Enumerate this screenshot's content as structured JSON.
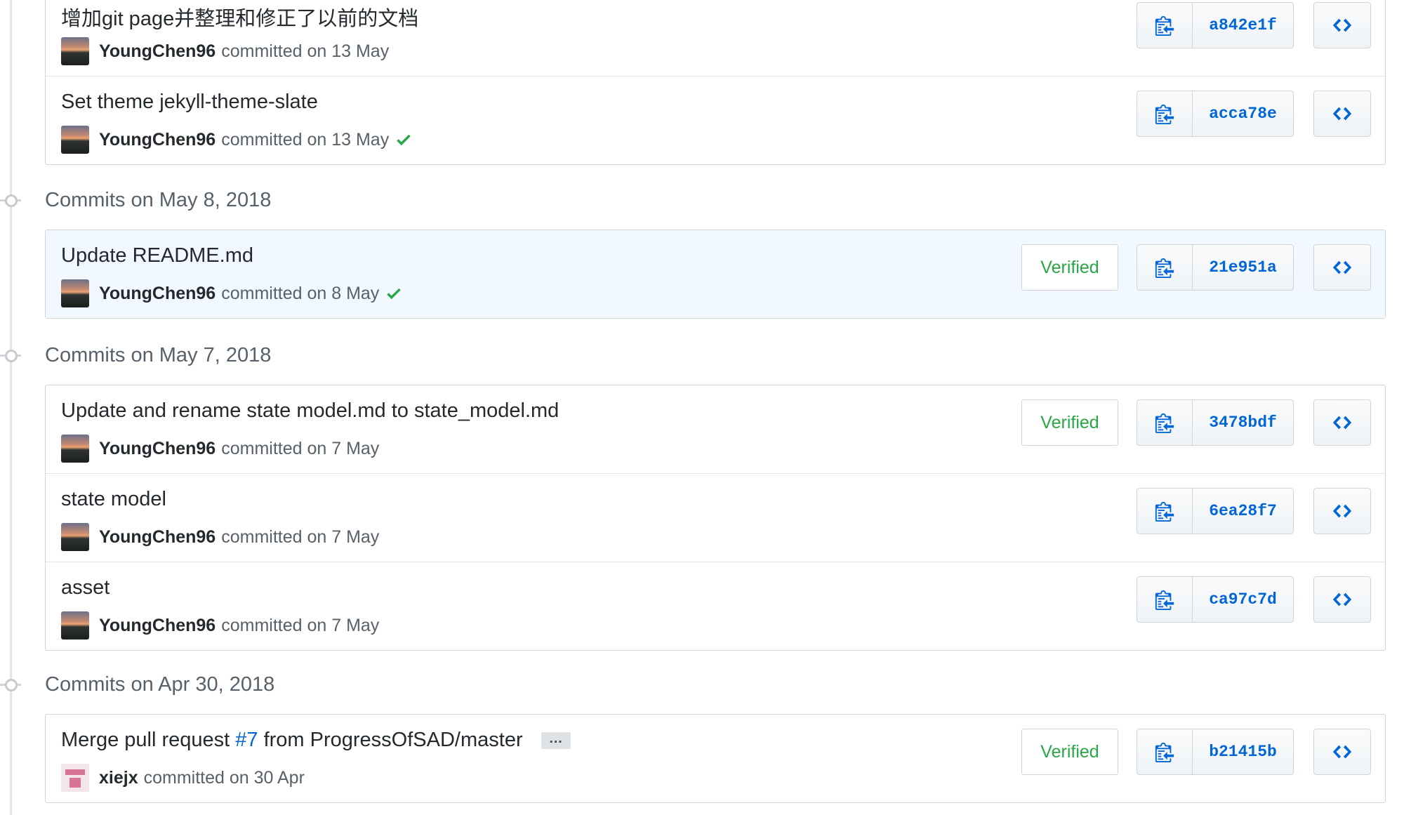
{
  "colors": {
    "link": "#0366d6",
    "verified": "#28a745",
    "check": "#28a745",
    "text": "#24292e",
    "muted": "#586069",
    "highlight_bg": "#f1f8ff"
  },
  "groups": [
    {
      "header": "",
      "commits": [
        {
          "message": "增加git page并整理和修正了以前的文档",
          "author": "YoungChen96",
          "committed": "committed on 13 May",
          "status_check": false,
          "verified": "",
          "sha": "a842e1f"
        },
        {
          "message": "Set theme jekyll-theme-slate",
          "author": "YoungChen96",
          "committed": "committed on 13 May",
          "status_check": true,
          "verified": "",
          "sha": "acca78e"
        }
      ]
    },
    {
      "header": "Commits on May 8, 2018",
      "commits": [
        {
          "message": "Update README.md",
          "author": "YoungChen96",
          "committed": "committed on 8 May",
          "status_check": true,
          "verified": "Verified",
          "sha": "21e951a"
        }
      ]
    },
    {
      "header": "Commits on May 7, 2018",
      "commits": [
        {
          "message": "Update and rename state model.md to state_model.md",
          "author": "YoungChen96",
          "committed": "committed on 7 May",
          "status_check": false,
          "verified": "Verified",
          "sha": "3478bdf"
        },
        {
          "message": "state model",
          "author": "YoungChen96",
          "committed": "committed on 7 May",
          "status_check": false,
          "verified": "",
          "sha": "6ea28f7"
        },
        {
          "message": "asset",
          "author": "YoungChen96",
          "committed": "committed on 7 May",
          "status_check": false,
          "verified": "",
          "sha": "ca97c7d"
        }
      ]
    },
    {
      "header": "Commits on Apr 30, 2018",
      "commits": [
        {
          "message": "Merge pull request",
          "issue": "#7",
          "message_suffix": "from ProgressOfSAD/master",
          "ellipsis": "…",
          "author": "xiejx",
          "committed": "committed on 30 Apr",
          "status_check": false,
          "verified": "Verified",
          "sha": "b21415b",
          "identicon": true
        }
      ]
    }
  ],
  "icons": {
    "copy": "clippy-icon",
    "browse": "code-icon",
    "check": "check-icon",
    "timeline": "git-commit-icon"
  }
}
